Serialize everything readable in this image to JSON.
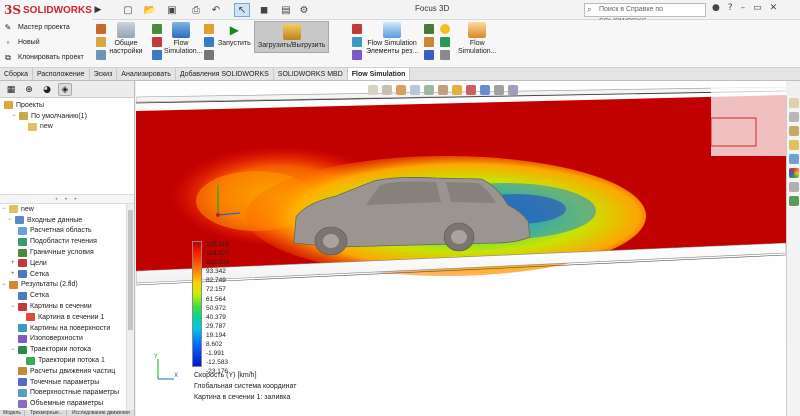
{
  "app": {
    "brand_prefix": "3S",
    "brand": "SOLIDWORKS",
    "document_title": "Focus 3D"
  },
  "search": {
    "placeholder": "Поиск в Справке по SOLIDWORKS"
  },
  "ribbon": {
    "left_items": [
      {
        "label": "Мастер проекта",
        "icon": "wizard-icon"
      },
      {
        "label": "Новый",
        "icon": "new-project-icon"
      },
      {
        "label": "Клонировать проект",
        "icon": "clone-project-icon"
      }
    ],
    "general_settings": "Общие настройки",
    "flow_simulation": "Flow Simulation...",
    "run": "Запустить",
    "load_unload": "Загрузить/Выгрузить",
    "elements_label_1": "Flow Simulation",
    "elements_label_2": "Элементы рез...",
    "flow_label_1": "Flow",
    "flow_label_2": "Simulation..."
  },
  "tabs": [
    "Сборка",
    "Расположение",
    "Эскиз",
    "Анализировать",
    "Добавления SOLIDWORKS",
    "SOLIDWORKS MBD",
    "Flow Simulation"
  ],
  "active_tab": "Flow Simulation",
  "projects_tree": {
    "root": "Проекты",
    "child": "По умолчанию(1)",
    "leaf": "new"
  },
  "results_tree": [
    {
      "label": "new",
      "level": 0
    },
    {
      "label": "Входные данные",
      "level": 1
    },
    {
      "label": "Расчетная область",
      "level": 2
    },
    {
      "label": "Подобласти течения",
      "level": 2
    },
    {
      "label": "Граничные условия",
      "level": 2
    },
    {
      "label": "Цели",
      "level": 2
    },
    {
      "label": "Сетка",
      "level": 2
    },
    {
      "label": "Результаты (2.fld)",
      "level": 1
    },
    {
      "label": "Сетка",
      "level": 2
    },
    {
      "label": "Картины в сечении",
      "level": 2
    },
    {
      "label": "Картина в сечении 1",
      "level": 3
    },
    {
      "label": "Картины на поверхности",
      "level": 2
    },
    {
      "label": "Изоповерхности",
      "level": 2
    },
    {
      "label": "Траектории потока",
      "level": 2
    },
    {
      "label": "Траектории потока 1",
      "level": 3
    },
    {
      "label": "Расчеты движения частиц",
      "level": 2
    },
    {
      "label": "Точечные параметры",
      "level": 2
    },
    {
      "label": "Поверхностные параметры",
      "level": 2
    },
    {
      "label": "Объемные параметры",
      "level": 2
    }
  ],
  "bottom_tabs": [
    "Модель",
    "Трехмерные...",
    "Исследование движения 1"
  ],
  "legend": {
    "values": [
      "125.118",
      "114.527",
      "103.934",
      "93.342",
      "82.749",
      "72.157",
      "61.564",
      "50.972",
      "40.379",
      "29.787",
      "19.194",
      "8.602",
      "-1.991",
      "-12.583",
      "-23.176"
    ],
    "caption_1": "Скорость (Y) [km/h]",
    "caption_2": "Глобальная система координат",
    "caption_3": "Картина в сечении 1: заливка"
  },
  "colors": {
    "accent_red": "#d2232a",
    "flow_hot": "#c00000",
    "flow_cold": "#0018d0"
  }
}
